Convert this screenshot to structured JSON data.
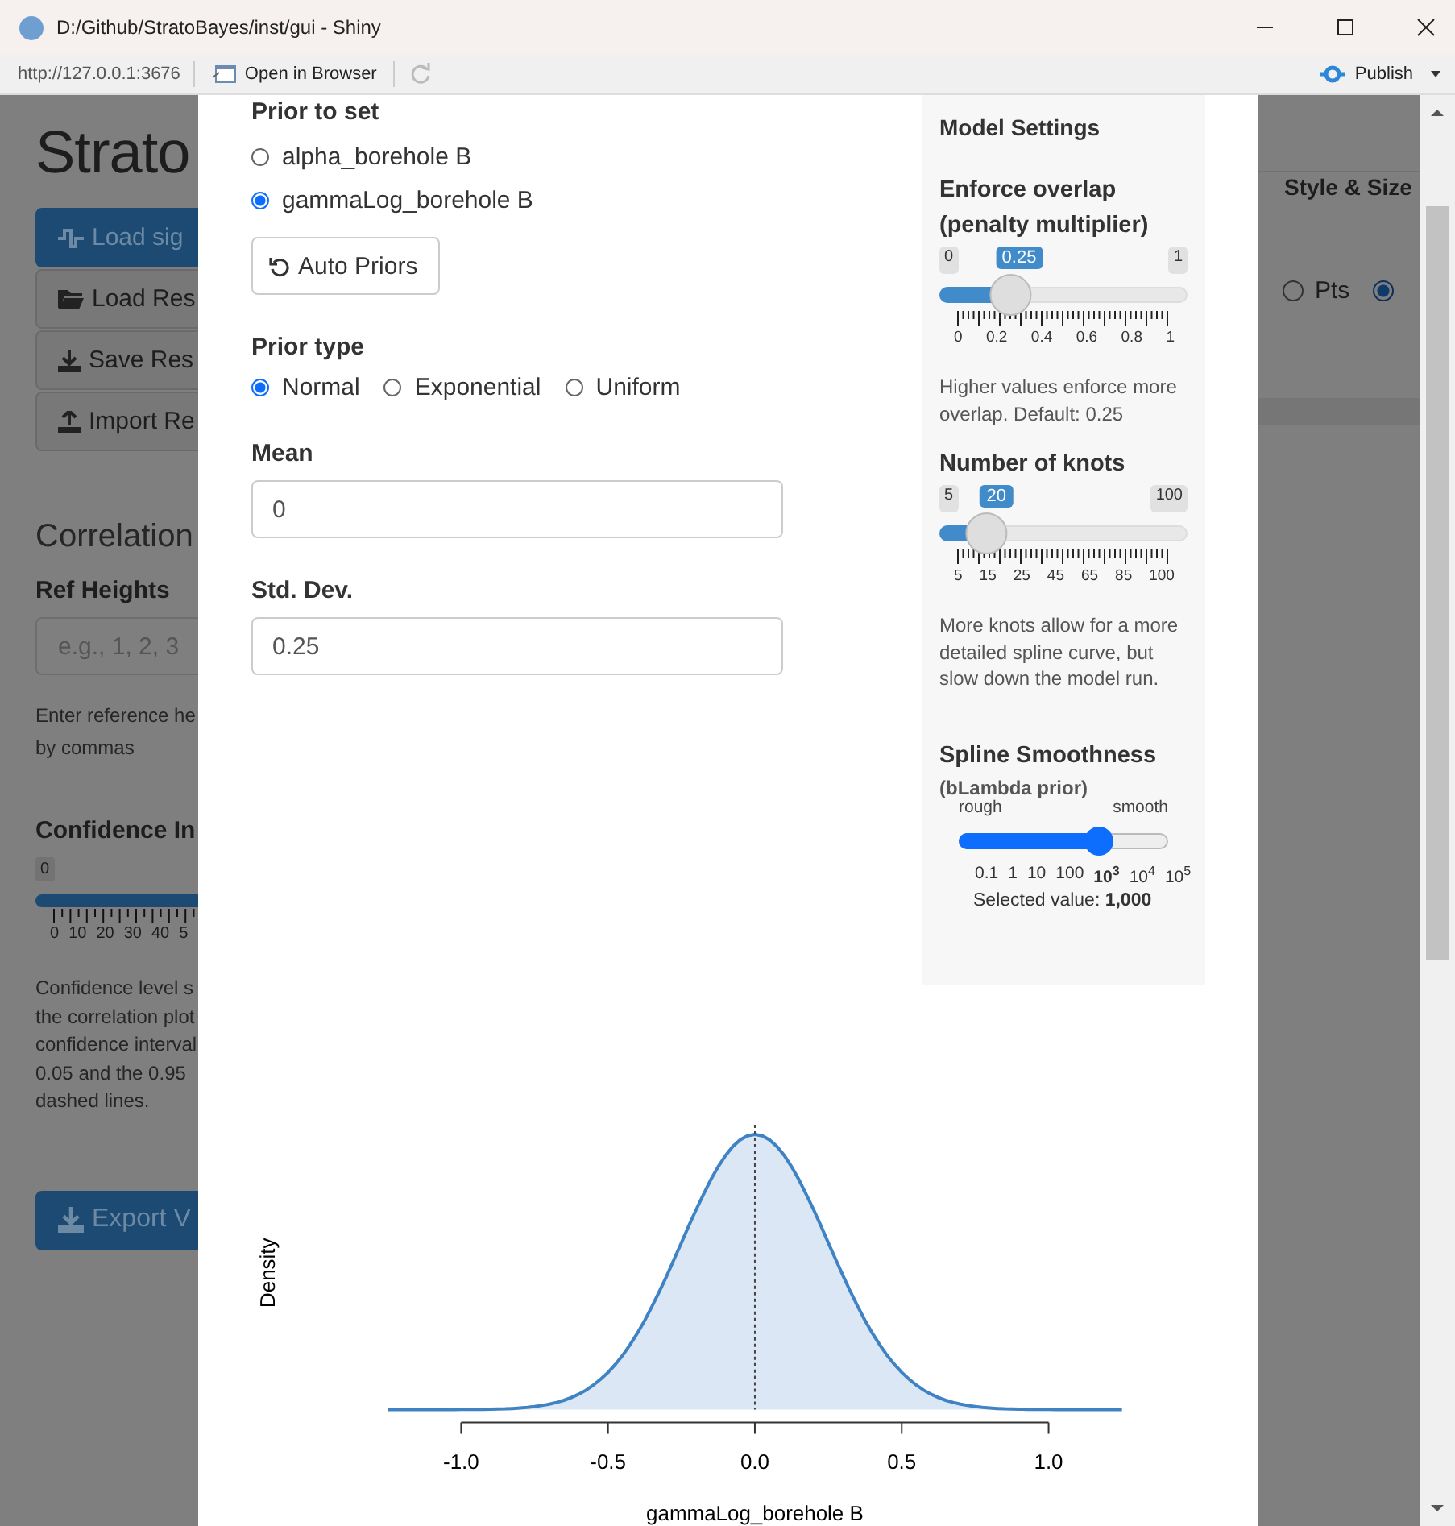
{
  "window": {
    "title": "D:/Github/StratoBayes/inst/gui - Shiny",
    "url": "http://127.0.0.1:3676",
    "open_in_browser": "Open in Browser",
    "publish": "Publish"
  },
  "background": {
    "app_title": "Strato",
    "buttons": [
      {
        "label": "Load sig",
        "primary": true
      },
      {
        "label": "Load Res",
        "primary": false
      },
      {
        "label": "Save Res",
        "primary": false
      },
      {
        "label": "Import Re",
        "primary": false
      }
    ],
    "section_title": "Correlation",
    "ref_heights": {
      "label": "Ref Heights",
      "placeholder": "e.g., 1, 2, 3"
    },
    "ref_help": [
      "Enter reference he",
      "by commas"
    ],
    "confidence": {
      "label": "Confidence In",
      "badge": "0",
      "ticks": [
        "0",
        "10",
        "20",
        "30",
        "40",
        "5"
      ],
      "help": [
        "Confidence level s",
        "the correlation plot",
        "confidence interval",
        "0.05 and the 0.95",
        "dashed lines."
      ]
    },
    "export": "Export V",
    "right": {
      "title": "Style & Size",
      "radios": [
        {
          "label": "Pts",
          "selected": false
        },
        {
          "selected": true
        }
      ]
    }
  },
  "modal": {
    "prior_to_set": {
      "label": "Prior to set",
      "options": [
        {
          "label": "alpha_borehole B",
          "selected": false
        },
        {
          "label": "gammaLog_borehole B",
          "selected": true
        }
      ]
    },
    "auto_priors": "Auto Priors",
    "prior_type": {
      "label": "Prior type",
      "options": [
        {
          "label": "Normal",
          "selected": true
        },
        {
          "label": "Exponential",
          "selected": false
        },
        {
          "label": "Uniform",
          "selected": false
        }
      ]
    },
    "mean": {
      "label": "Mean",
      "value": "0"
    },
    "sd": {
      "label": "Std. Dev.",
      "value": "0.25"
    },
    "settings": {
      "title": "Model Settings",
      "overlap": {
        "label": "Enforce overlap (penalty multiplier)",
        "min": "0",
        "max": "1",
        "value": "0.25",
        "level": 0.25,
        "ticks": [
          "0",
          "0.2",
          "0.4",
          "0.6",
          "0.8",
          "1"
        ],
        "help": "Higher values enforce more overlap. Default: 0.25"
      },
      "knots": {
        "label": "Number of knots",
        "min": "5",
        "max": "100",
        "value": "20",
        "level": 0.158,
        "ticks": [
          "5",
          "15",
          "25",
          "45",
          "65",
          "85",
          "100"
        ],
        "help": "More knots allow for a more detailed spline curve, but slow down the model run."
      },
      "smoothness": {
        "label": "Spline Smoothness",
        "subtitle": "(bLambda prior)",
        "left": "rough",
        "right": "smooth",
        "level": 0.667,
        "ticks": [
          {
            "label": "0.1",
            "selected": false
          },
          {
            "label": "1",
            "selected": false
          },
          {
            "label": "10",
            "selected": false
          },
          {
            "label": "100",
            "selected": false
          },
          {
            "label": "10$^{3}$",
            "selected": true
          },
          {
            "label": "10$^{4}$",
            "selected": false
          },
          {
            "label": "10$^{5}$",
            "selected": false
          }
        ],
        "selected_text": "Selected value: **1,000**"
      }
    },
    "plot": {
      "ylabel": "Density",
      "xlabel": "gammaLog_borehole B",
      "xticks": [
        "-1.0",
        "-0.5",
        "0.0",
        "0.5",
        "1.0"
      ]
    }
  }
}
